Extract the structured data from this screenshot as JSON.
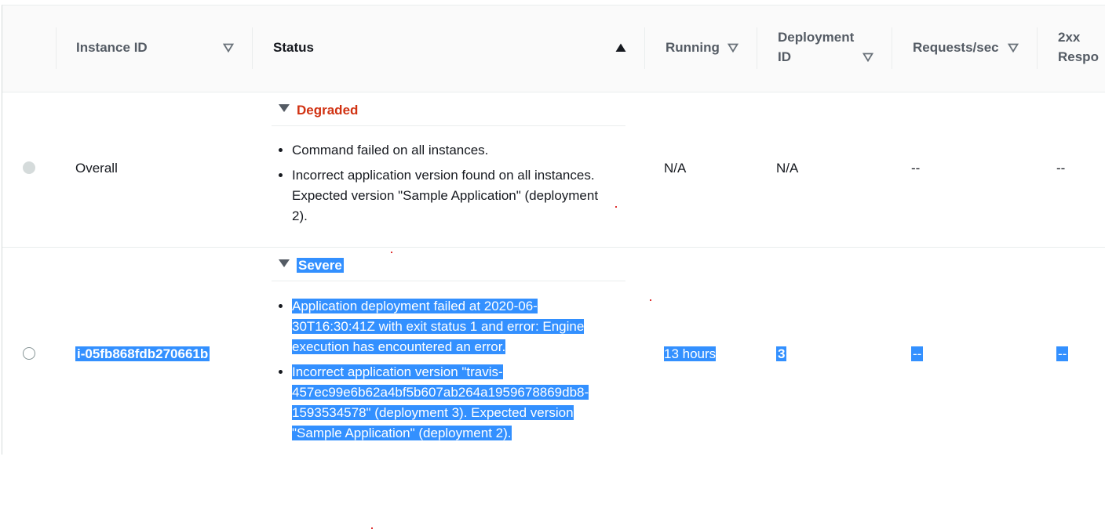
{
  "table": {
    "columns": [
      {
        "label": "Instance ID",
        "sort": "filter"
      },
      {
        "label": "Status",
        "sort": "ascending"
      },
      {
        "label": "Running",
        "sort": "filter"
      },
      {
        "label_line1": "Deployment",
        "label_line2": "ID",
        "sort": "filter"
      },
      {
        "label": "Requests/sec",
        "sort": "filter"
      },
      {
        "label_line1": "2xx",
        "label_line2": "Respo"
      }
    ],
    "rows": [
      {
        "instance_id": "Overall",
        "status": "Degraded",
        "messages": [
          "Command failed on all instances.",
          "Incorrect application version found on all instances. Expected version \"Sample Application\" (deployment 2)."
        ],
        "running": "N/A",
        "deployment_id": "N/A",
        "requests_sec": "--",
        "responses_2xx": "--"
      },
      {
        "instance_id": "i-05fb868fdb270661b",
        "status": "Severe",
        "messages_lines": [
          [
            "Application deployment failed at 2020-06-",
            "30T16:30:41Z with exit status 1 and error: Engine",
            "execution has encountered an error."
          ],
          [
            "Incorrect application version \"travis-",
            "457ec99e6b62a4bf5b607ab264a1959678869db8-",
            "1593534578\" (deployment 3). Expected version",
            "\"Sample Application\" (deployment 2)."
          ]
        ],
        "running": "13 hours",
        "deployment_id": "3",
        "requests_sec": "--",
        "responses_2xx": "--"
      }
    ]
  },
  "colors": {
    "degraded": "#d13212",
    "selection": "#3390ff",
    "header_bg": "#fafafa"
  }
}
